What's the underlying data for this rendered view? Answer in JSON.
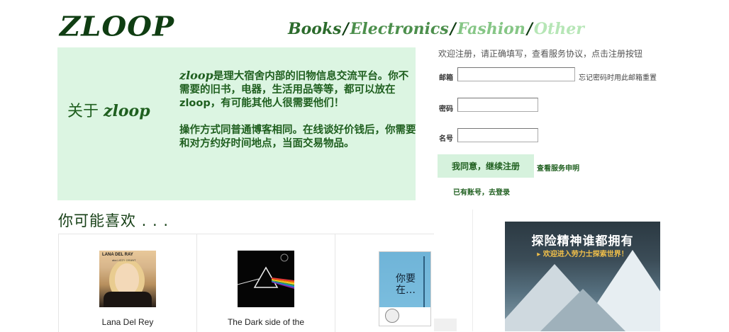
{
  "header": {
    "logo": "ZLOOP",
    "nav": [
      {
        "label": "Books",
        "color": "#2c6b2c"
      },
      {
        "label": "Electronics",
        "color": "#4c8f4c"
      },
      {
        "label": "Fashion",
        "color": "#86c686"
      },
      {
        "label": "Other",
        "color": "#b6e6b6"
      }
    ],
    "separator": "/"
  },
  "about": {
    "title_prefix": "关于 ",
    "title_brand": "zloop",
    "brand": "zloop",
    "paragraph1": "是理大宿舍内部的旧物信息交流平台。你不需要的旧书，电器，生活用品等等，都可以放在zloop，有可能其他人很需要他们！",
    "paragraph2": "操作方式同普通博客相同。在线谈好价钱后，你需要和对方约好时间地点，当面交易物品。"
  },
  "recommend": {
    "heading": "你可能喜欢 . . .",
    "items": [
      {
        "caption": "Lana Del Rey",
        "cover_title": "LANA DEL RAY",
        "cover_sub": "aka LIZZY GRANT"
      },
      {
        "caption": "The Dark side of the",
        "cover_title": ""
      },
      {
        "caption": "",
        "cover_title": "你要在…"
      }
    ]
  },
  "register": {
    "intro": "欢迎注册，请正确填写，查看服务协议，点击注册按钮",
    "email_label": "邮箱",
    "email_value": "",
    "forgot": "忘记密码时用此邮箱重置",
    "password_label": "密码",
    "password_value": "",
    "name_label": "名号",
    "name_value": "",
    "agree_button": "我同意，继续注册",
    "terms_link": "查看服务申明",
    "login_link": "已有账号，去登录"
  },
  "ad": {
    "title": "探险精神谁都拥有",
    "subtitle": "▸ 欢迎进入劳力士探索世界！"
  }
}
